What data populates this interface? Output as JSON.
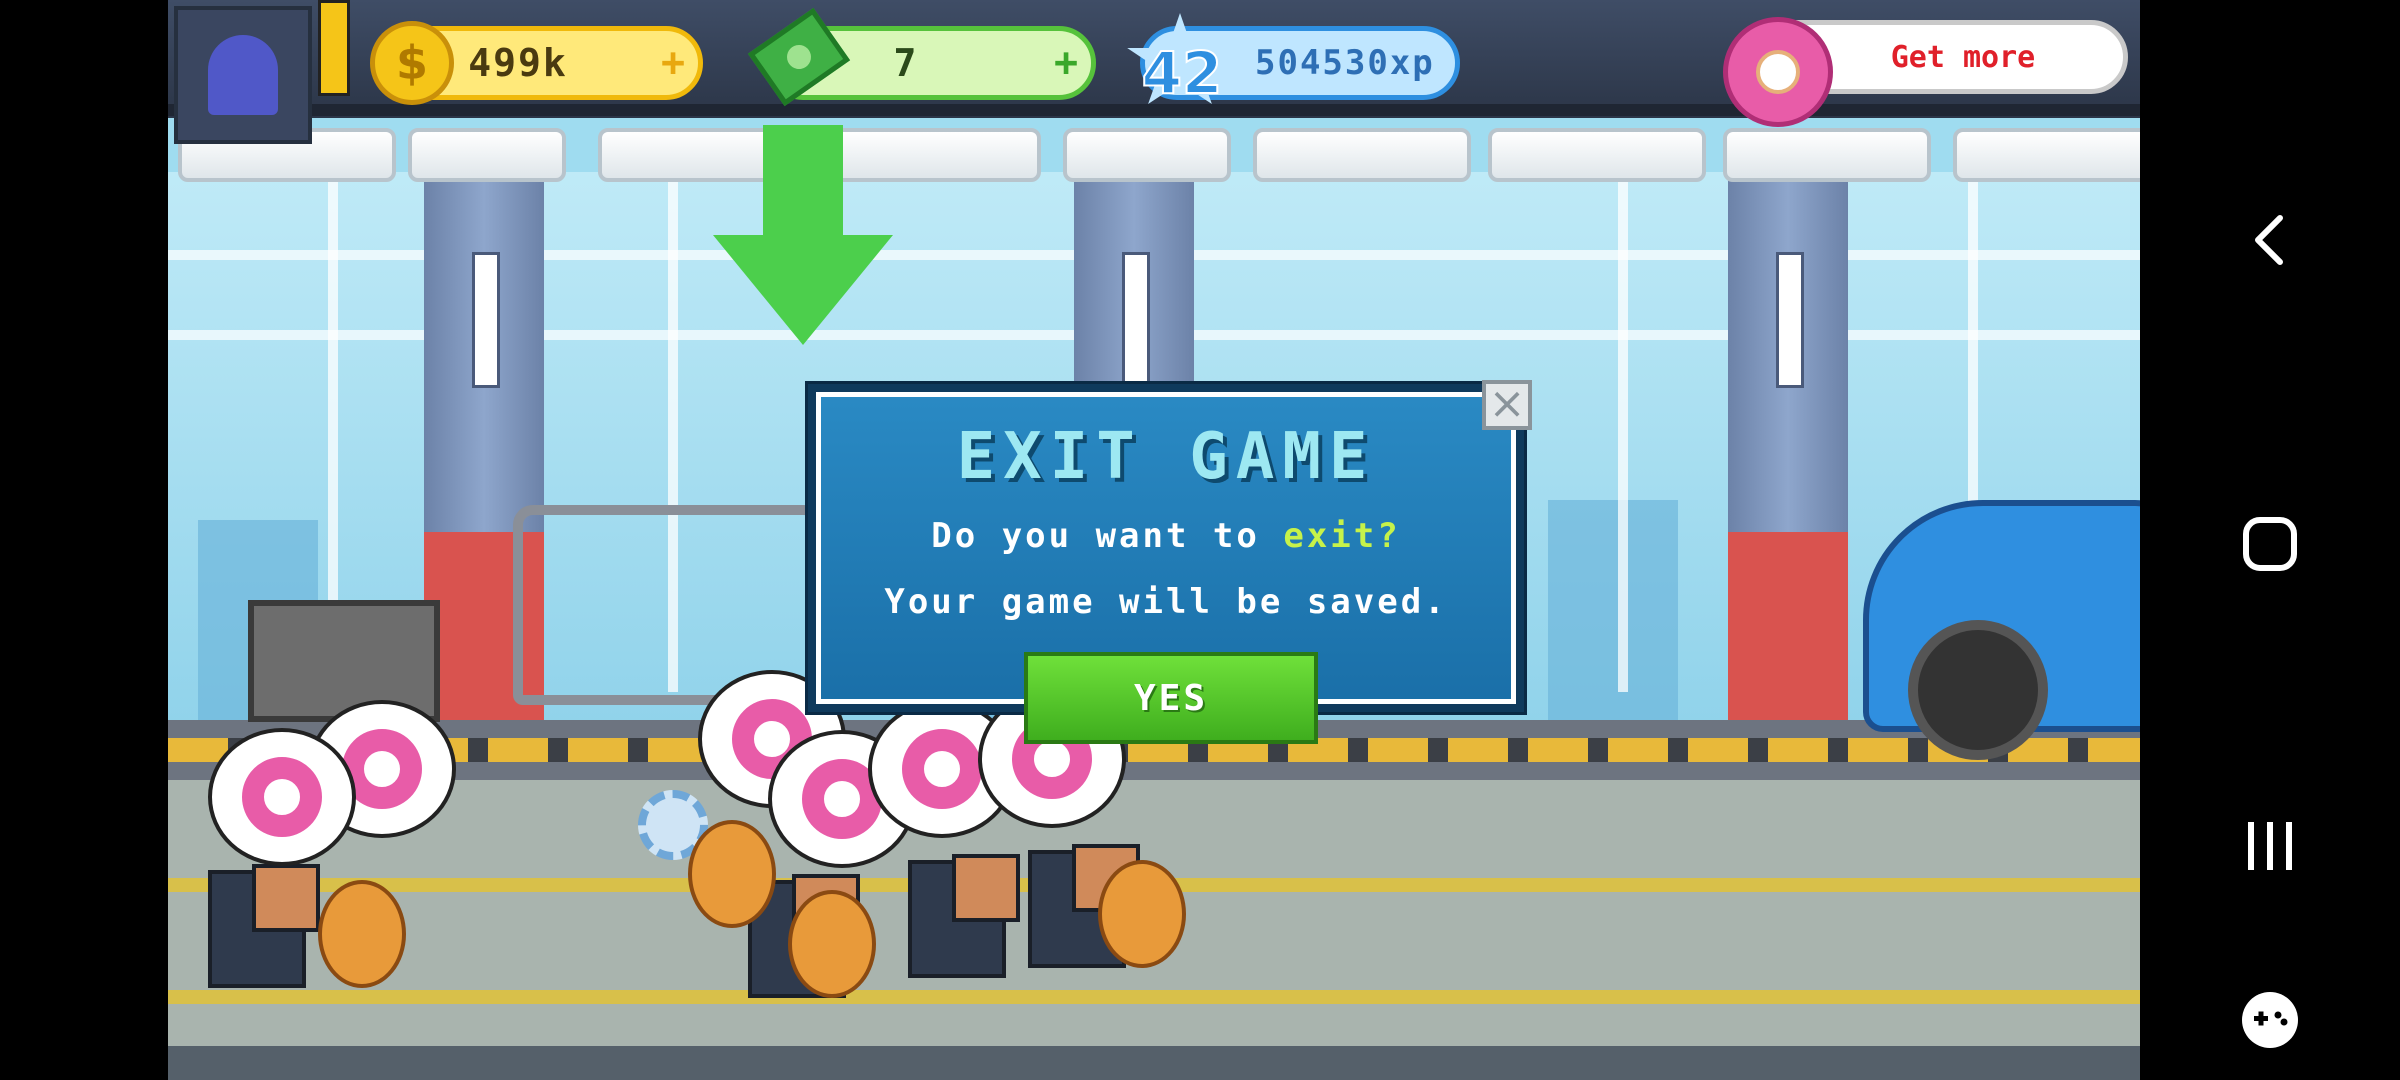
{
  "hud": {
    "coins": "499k",
    "coins_plus": "+",
    "cash": "7",
    "cash_plus": "+",
    "level": "42",
    "xp": "504530xp",
    "donut_cta": "Get more",
    "coin_symbol": "$"
  },
  "dialog": {
    "title": "EXIT GAME",
    "line1_prefix": "Do you want to ",
    "line1_highlight": "exit?",
    "line2": "Your game will be saved.",
    "confirm_label": "YES",
    "close_symbol": "×"
  },
  "colors": {
    "dialog_bg": "#1a6fa8",
    "title": "#9de8f2",
    "highlight": "#c6f24a",
    "yes_button": "#4cc72a",
    "coin": "#f5c518",
    "cash": "#3fb045",
    "xp": "#2e8fe0",
    "donut": "#e85ca8"
  },
  "icons": [
    "profile-icon",
    "coin-icon",
    "cash-icon",
    "level-star-icon",
    "donut-icon",
    "close-icon",
    "back-icon",
    "home-icon",
    "recents-icon",
    "gamepad-icon"
  ]
}
